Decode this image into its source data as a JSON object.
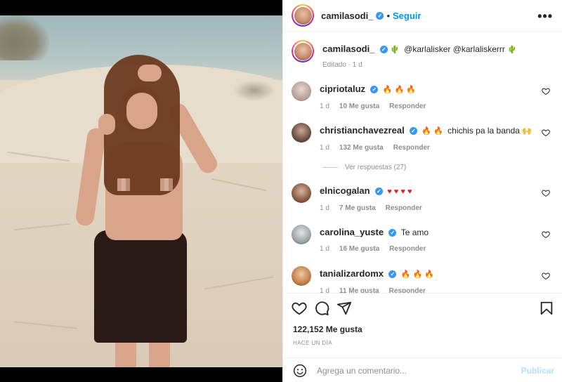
{
  "post": {
    "author": "camilasodi_",
    "follow_label": "Seguir",
    "more_label": "•••",
    "caption_mentions": "@karlalisker @karlaliskerrr",
    "caption_emoji": "🌵",
    "caption_meta": "Editado · 1 d",
    "likes": "122,152 Me gusta",
    "posted_ago": "HACE UN DÍA"
  },
  "comments": [
    {
      "user": "cipriotaluz",
      "text": "",
      "emoji": "🔥 🔥 🔥",
      "time": "1 d",
      "likes": "10 Me gusta",
      "reply": "Responder"
    },
    {
      "user": "christianchavezreal",
      "text": "chichis pa la banda",
      "emoji_before": "🔥 🔥",
      "emoji_after": "🙌",
      "time": "1 d",
      "likes": "132 Me gusta",
      "reply": "Responder",
      "view_replies": "Ver respuestas (27)"
    },
    {
      "user": "elnicogalan",
      "text": "",
      "emoji": "♥ ♥ ♥ ♥",
      "time": "1 d",
      "likes": "7 Me gusta",
      "reply": "Responder"
    },
    {
      "user": "carolina_yuste",
      "text": "Te amo",
      "time": "1 d",
      "likes": "16 Me gusta",
      "reply": "Responder"
    },
    {
      "user": "tanializardomx",
      "text": "",
      "emoji": "🔥 🔥 🔥",
      "time": "1 d",
      "likes": "11 Me gusta",
      "reply": "Responder"
    }
  ],
  "composer": {
    "placeholder": "Agrega un comentario...",
    "publish_label": "Publicar"
  },
  "icons": {
    "verified": "verified-badge-icon",
    "heart": "heart-icon",
    "comment": "comment-icon",
    "share": "share-icon",
    "save": "bookmark-icon",
    "emoji": "emoji-icon",
    "more": "more-options-icon"
  },
  "colors": {
    "accent": "#0095f6",
    "verified": "#3897f0",
    "publish_disabled": "#b2dffc",
    "muted": "#8e8e8e"
  }
}
